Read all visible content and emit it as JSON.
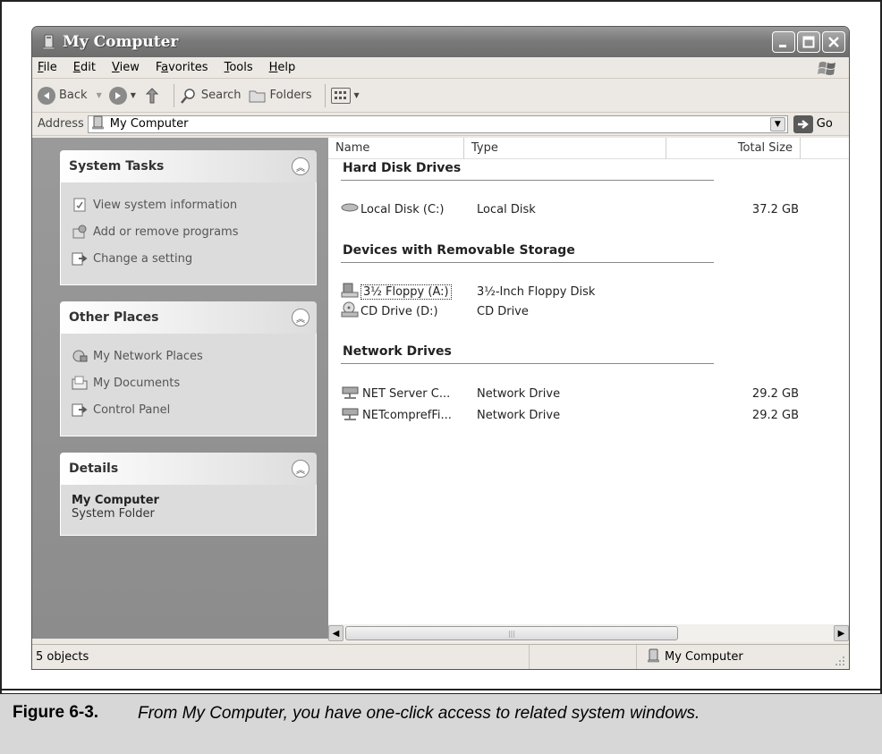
{
  "window": {
    "title": "My Computer",
    "icon": "my-computer-icon"
  },
  "menu": [
    "File",
    "Edit",
    "View",
    "Favorites",
    "Tools",
    "Help"
  ],
  "menu_accel": [
    "F",
    "E",
    "V",
    "a",
    "T",
    "H"
  ],
  "toolbar": {
    "back_label": "Back",
    "search_label": "Search",
    "folders_label": "Folders"
  },
  "address": {
    "label": "Address",
    "value": "My Computer",
    "go_label": "Go"
  },
  "task_panels": {
    "system_tasks": {
      "title": "System Tasks",
      "items": [
        "View system information",
        "Add or remove programs",
        "Change a setting"
      ]
    },
    "other_places": {
      "title": "Other Places",
      "items": [
        "My Network Places",
        "My Documents",
        "Control Panel"
      ]
    },
    "details": {
      "title": "Details",
      "name": "My Computer",
      "type": "System Folder"
    }
  },
  "columns": [
    "Name",
    "Type",
    "Total Size"
  ],
  "groups": {
    "hard_disk": {
      "title": "Hard Disk Drives",
      "items": [
        {
          "name": "Local Disk (C:)",
          "type": "Local Disk",
          "size": "37.2 GB"
        }
      ]
    },
    "removable": {
      "title": "Devices with Removable Storage",
      "items": [
        {
          "name": "3½ Floppy (A:)",
          "type": "3½-Inch Floppy Disk",
          "size": ""
        },
        {
          "name": "CD Drive (D:)",
          "type": "CD Drive",
          "size": ""
        }
      ]
    },
    "network": {
      "title": "Network Drives",
      "items": [
        {
          "name": "NET Server C...",
          "type": "Network Drive",
          "size": "29.2 GB"
        },
        {
          "name": "NETcomprefFi...",
          "type": "Network Drive",
          "size": "29.2 GB"
        }
      ]
    }
  },
  "status": {
    "objects": "5 objects",
    "location": "My Computer"
  },
  "caption": {
    "figure": "Figure 6-3.",
    "text": "From My Computer, you have one-click access to related system windows."
  }
}
